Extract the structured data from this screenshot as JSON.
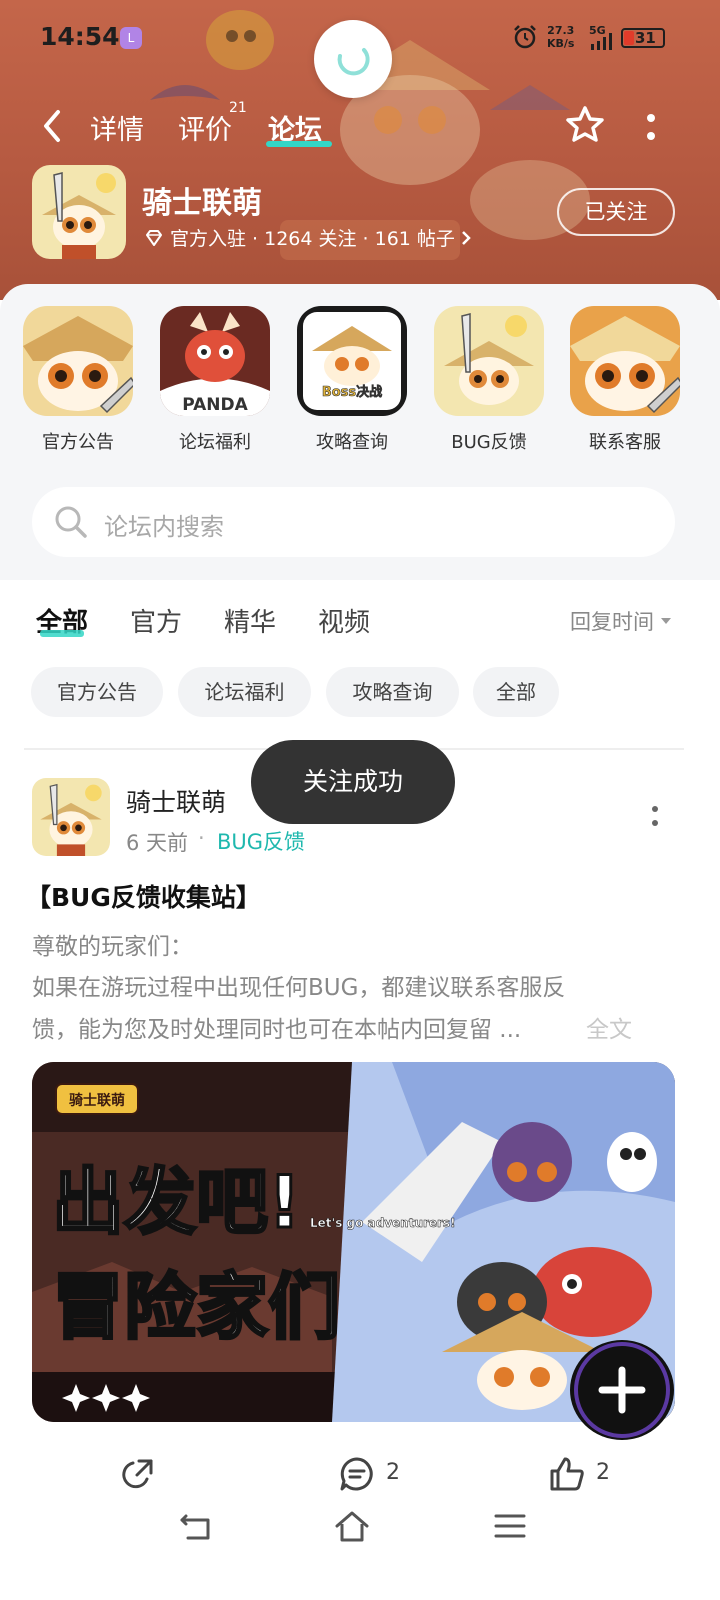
{
  "status_bar": {
    "time": "14:54",
    "app_badge": "L",
    "net_speed_value": "27.3",
    "net_speed_unit": "KB/s",
    "signal_label": "5G",
    "battery": "31"
  },
  "header": {
    "tabs": [
      {
        "label": "详情"
      },
      {
        "label": "评价",
        "badge": "21"
      },
      {
        "label": "论坛"
      }
    ],
    "active_tab": "论坛",
    "game": {
      "name": "骑士联萌",
      "meta": "官方入驻 · 1264 关注 · 161 帖子",
      "follow_label": "已关注"
    }
  },
  "shortcuts": [
    {
      "label": "官方公告",
      "icon": "panda-knight-art"
    },
    {
      "label": "论坛福利",
      "icon": "panda-dragon-art",
      "caption": "PANDA"
    },
    {
      "label": "攻略查询",
      "icon": "boss-guide-art",
      "caption": "Boss决战"
    },
    {
      "label": "BUG反馈",
      "icon": "panda-knight-art"
    },
    {
      "label": "联系客服",
      "icon": "panda-knight-art"
    }
  ],
  "search": {
    "placeholder": "论坛内搜索"
  },
  "filters": {
    "tabs": [
      "全部",
      "官方",
      "精华",
      "视频"
    ],
    "active": "全部",
    "sort_label": "回复时间",
    "chips": [
      "官方公告",
      "论坛福利",
      "攻略查询",
      "全部"
    ]
  },
  "post": {
    "author": "骑士联萌",
    "time": "6 天前",
    "separator": "·",
    "category": "BUG反馈",
    "title": "【BUG反馈收集站】",
    "line1": "尊敬的玩家们：",
    "line2": " 如果在游玩过程中出现任何BUG，都建议联系客服反",
    "line3": "馈，能为您及时处理同时也可在本帖内回复留 ...",
    "read_more": "全文",
    "image": {
      "logo_text": "骑士联萌",
      "headline_1": "出发吧!",
      "headline_2": "冒险家们",
      "tagline": "Let's go adventurers!"
    },
    "actions": {
      "share_icon": "share-icon",
      "comments": "2",
      "likes": "2"
    }
  },
  "toast": "关注成功",
  "colors": {
    "accent": "#33d6c6",
    "category": "#1fb8ae",
    "header_bg": "#b65a41",
    "toast_bg": "#333333"
  }
}
